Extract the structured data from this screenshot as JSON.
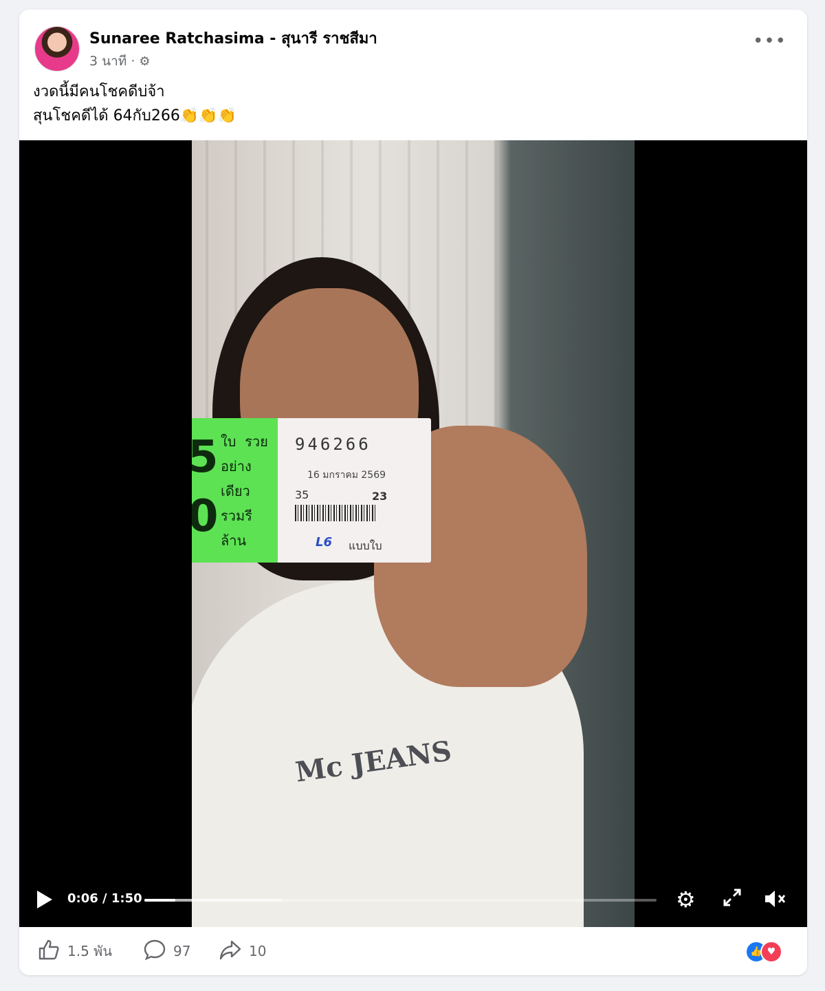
{
  "post": {
    "author": "Sunaree Ratchasima - สุนารี ราชสีมา",
    "time": "3 นาที",
    "separator": "·",
    "caption_line1": "งวดนี้มีคนโชคดีบ่จ้า",
    "caption_line2": "สุนโชคดีได้ 64กับ266👏👏👏",
    "more_label": "•••"
  },
  "video": {
    "current_time": "0:06",
    "duration": "1:50",
    "time_display": "0:06 / 1:50",
    "progress_fraction": 0.06,
    "buffered_fraction": 0.27,
    "ticket_number": "946266",
    "ticket_date": "16 มกราคม 2569",
    "ticket_big_text": "5\n0",
    "ticket_green_text": "ใบ  รวย\nอย่าง\nเดียว\nรวมรี\nล้าน",
    "ticket_set": "35",
    "ticket_suffix": "23",
    "ticket_logo": "L6",
    "ticket_type": "แบบใบ",
    "shirt_text": "Mc JEANS"
  },
  "footer": {
    "likes": "1.5 พัน",
    "comments": "97",
    "shares": "10"
  },
  "colors": {
    "accent": "#1877f2",
    "love": "#f33e58",
    "muted_text": "#65676b",
    "ticket_green": "#5de254"
  },
  "icons": {
    "play": "play-icon",
    "settings": "gear-icon",
    "fullscreen": "fullscreen-icon",
    "mute": "muted-speaker-icon",
    "like": "thumbs-up-icon",
    "comment": "comment-bubble-icon",
    "share": "share-arrow-icon",
    "privacy": "gear-privacy-icon"
  }
}
